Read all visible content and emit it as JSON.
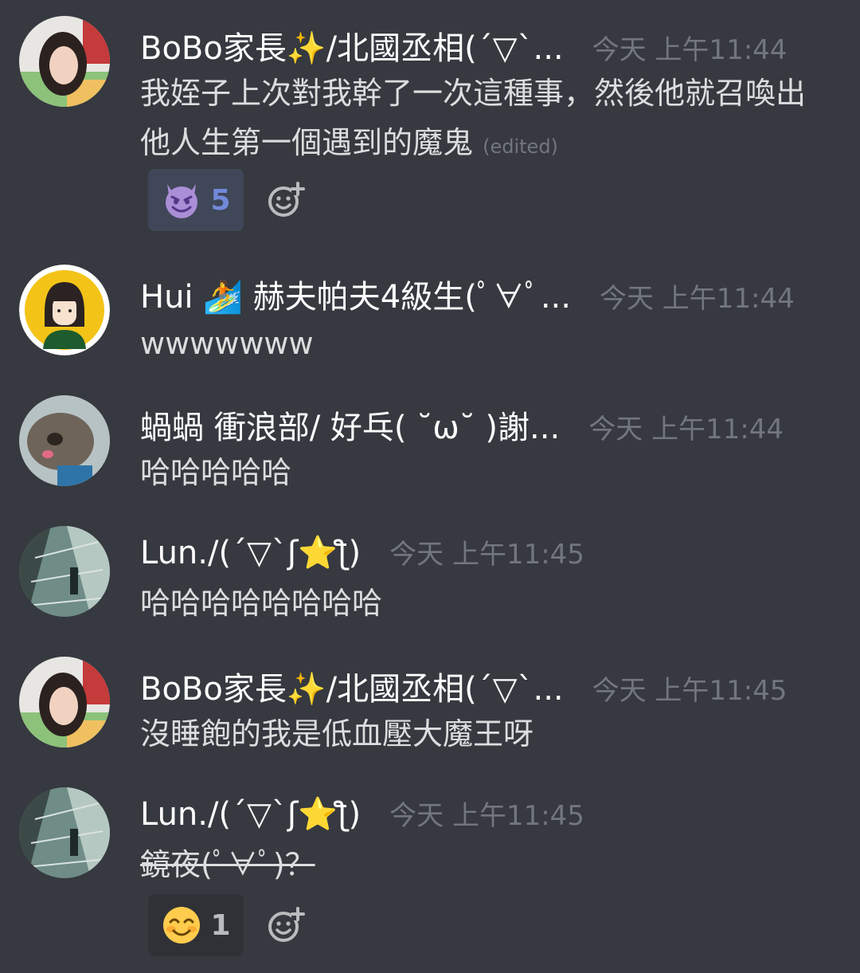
{
  "messages": [
    {
      "author": "BoBo家長✨/北國丞相(´▽`...",
      "time": "今天 上午11:44",
      "text": "我姪子上次對我幹了一次這種事，然後他就召喚出他人生第一個遇到的魔鬼",
      "edited": "(edited)",
      "reaction": {
        "emoji": "smiling-imp",
        "count": "5"
      }
    },
    {
      "author": "Hui 🏄 赫夫帕夫4級生(ﾟ∀ﾟ...",
      "time": "今天 上午11:44",
      "text": "wwwwwww"
    },
    {
      "author": "蝸蝸 衝浪部/ 好乓( ˘ω˘ )謝...",
      "time": "今天 上午11:44",
      "text": "哈哈哈哈哈"
    },
    {
      "author": "Lun./(´▽`ʃ⭐ƪ)",
      "time": "今天 上午11:45",
      "text": "哈哈哈哈哈哈哈哈"
    },
    {
      "author": "BoBo家長✨/北國丞相(´▽`...",
      "time": "今天 上午11:45",
      "text": "沒睡飽的我是低血壓大魔王呀"
    },
    {
      "author": "Lun./(´▽`ʃ⭐ƪ)",
      "time": "今天 上午11:45",
      "text": "鏡夜(ﾟ∀ﾟ)？",
      "reaction": {
        "emoji": "smiling-face-blush",
        "count": "1"
      }
    }
  ],
  "icons": {
    "add_reaction": "add-reaction-icon"
  },
  "colors": {
    "background": "#36393f",
    "author": "#ffffff",
    "timestamp": "#72767d",
    "text": "#dcddde",
    "reaction_active_bg": "#3f4758",
    "reaction_active_count": "#7289da"
  }
}
